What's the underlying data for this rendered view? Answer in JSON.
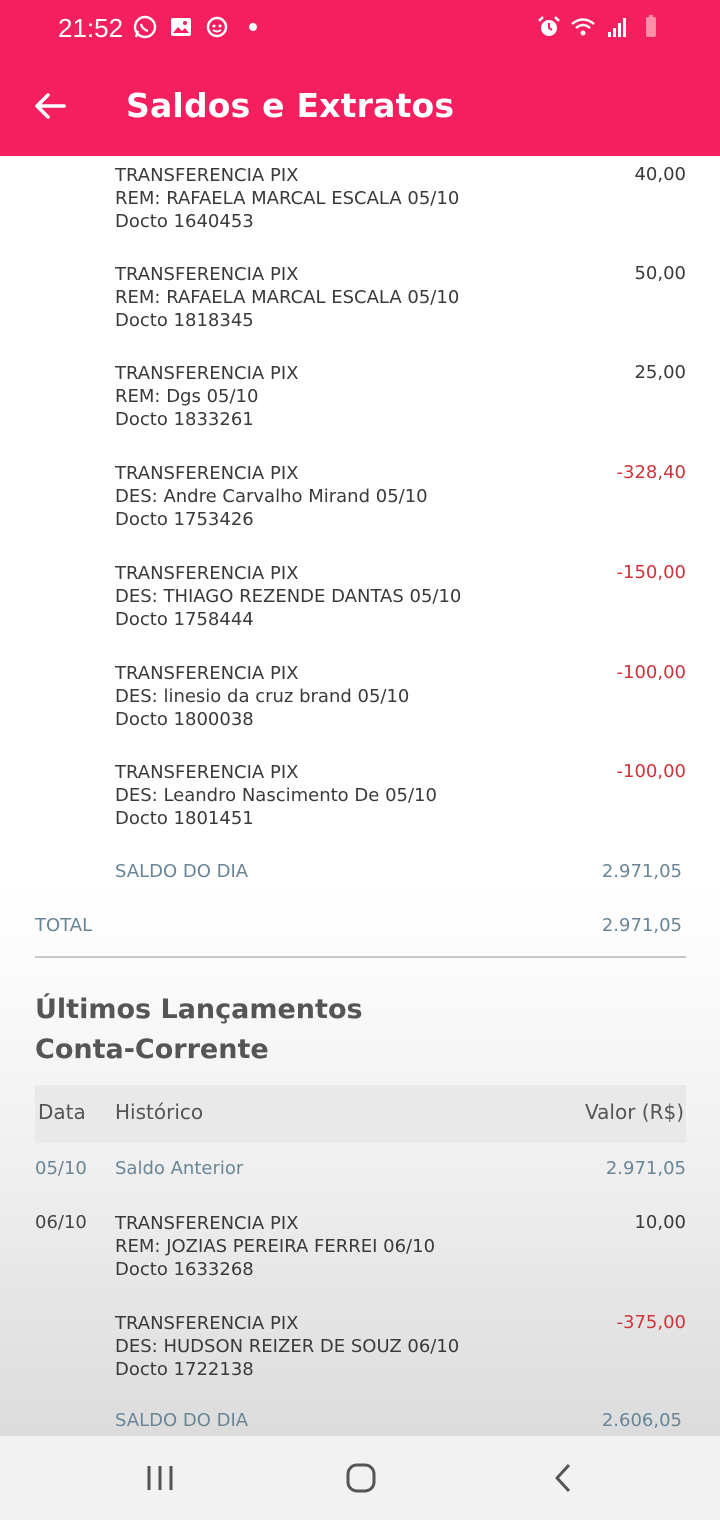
{
  "status_bar": {
    "time": "21:52",
    "left_icons": [
      "whatsapp-icon",
      "gallery-icon",
      "sync-icon",
      "dot-icon"
    ],
    "right_icons": [
      "alarm-icon",
      "wifi-icon",
      "signal-icon",
      "battery-icon"
    ]
  },
  "header": {
    "title": "Saldos e Extratos",
    "accent_color": "#f31f5f"
  },
  "day1": {
    "transactions": [
      {
        "lines": [
          "TRANSFERENCIA PIX",
          "REM: RAFAELA MARCAL ESCALA 05/10",
          "Docto 1640453"
        ],
        "value": "40,00",
        "negative": false
      },
      {
        "lines": [
          "TRANSFERENCIA PIX",
          "REM: RAFAELA MARCAL ESCALA 05/10",
          "Docto 1818345"
        ],
        "value": "50,00",
        "negative": false
      },
      {
        "lines": [
          "TRANSFERENCIA PIX",
          "REM: Dgs 05/10",
          "Docto 1833261"
        ],
        "value": "25,00",
        "negative": false
      },
      {
        "lines": [
          "TRANSFERENCIA PIX",
          "DES: Andre Carvalho Mirand 05/10",
          "Docto 1753426"
        ],
        "value": "-328,40",
        "negative": true
      },
      {
        "lines": [
          "TRANSFERENCIA PIX",
          "DES: THIAGO REZENDE DANTAS 05/10",
          "Docto 1758444"
        ],
        "value": "-150,00",
        "negative": true
      },
      {
        "lines": [
          "TRANSFERENCIA PIX",
          "DES: linesio da cruz brand 05/10",
          "Docto 1800038"
        ],
        "value": "-100,00",
        "negative": true
      },
      {
        "lines": [
          "TRANSFERENCIA PIX",
          "DES: Leandro Nascimento De 05/10",
          "Docto 1801451"
        ],
        "value": "-100,00",
        "negative": true
      }
    ],
    "saldo_label": "SALDO DO DIA",
    "saldo_value": "2.971,05"
  },
  "total": {
    "label": "TOTAL",
    "value": "2.971,05"
  },
  "section": {
    "title_line1": "Últimos Lançamentos",
    "title_line2": "Conta-Corrente"
  },
  "table": {
    "col_data": "Data",
    "col_historico": "Histórico",
    "col_valor": "Valor (R$)"
  },
  "saldo_anterior": {
    "date": "05/10",
    "label": "Saldo Anterior",
    "value": "2.971,05"
  },
  "day2": {
    "date": "06/10",
    "transactions": [
      {
        "lines": [
          "TRANSFERENCIA PIX",
          "REM: JOZIAS PEREIRA FERREI 06/10",
          "Docto 1633268"
        ],
        "value": "10,00",
        "negative": false
      },
      {
        "lines": [
          "TRANSFERENCIA PIX",
          "DES: HUDSON REIZER DE SOUZ 06/10",
          "Docto 1722138"
        ],
        "value": "-375,00",
        "negative": true
      }
    ],
    "saldo_label": "SALDO DO DIA",
    "saldo_value": "2.606,05"
  },
  "colors": {
    "negative": "#d0343a",
    "muted": "#6a8596"
  }
}
